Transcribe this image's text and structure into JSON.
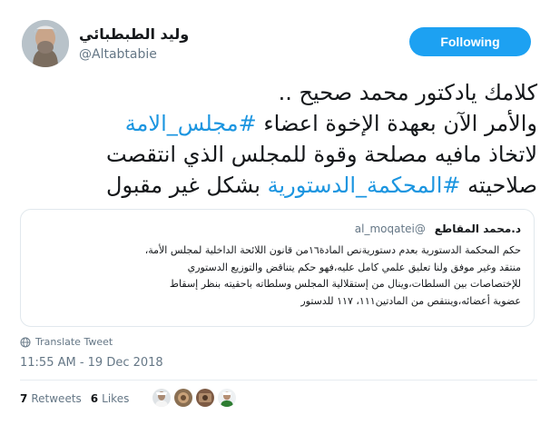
{
  "author": {
    "display_name": "وليد الطبطبائي",
    "handle": "@Altabtabie"
  },
  "follow_button": {
    "label": "Following"
  },
  "tweet": {
    "lines": [
      [
        {
          "text": "كلامك يادكتور محمد صحيح ..",
          "hashtag": false
        }
      ],
      [
        {
          "text": "والأمر الآن بعهدة الإخوة اعضاء ",
          "hashtag": false
        },
        {
          "text": "#مجلس_الامة",
          "hashtag": true
        }
      ],
      [
        {
          "text": "لاتخاذ مافيه مصلحة وقوة للمجلس الذي انتقصت",
          "hashtag": false
        }
      ],
      [
        {
          "text": "صلاحيته ",
          "hashtag": false
        },
        {
          "text": "#المحكمة_الدستورية",
          "hashtag": true
        },
        {
          "text": " بشكل غير مقبول",
          "hashtag": false
        }
      ]
    ]
  },
  "quoted_tweet": {
    "name": "د.محمد المقاطع",
    "handle": "@al_moqatei",
    "lines": [
      "حكم المحكمة الدستورية بعدم دستوريةنص المادة١٦من قانون اللائحة الداخلية لمجلس الأمة،",
      "منتقد وغير موفق ولنا تعليق علمي كامل عليه،فهو حكم يتناقض والتوزيع الدستوري",
      "للإختصاصات بين السلطات،وينال من إستقلالية المجلس وسلطاته باحقيته بنظر إسقاط",
      "عضوية أعضائه،وينتقص من المادتين١١١، ١١٧ للدستور"
    ]
  },
  "translate_link": "Translate Tweet",
  "timestamp": "11:55 AM - 19 Dec 2018",
  "stats": {
    "retweets_count": "7",
    "retweets_label": "Retweets",
    "likes_count": "6",
    "likes_label": "Likes"
  },
  "icons": {
    "translate": "globe-icon"
  },
  "colors": {
    "accent": "#1da1f2",
    "hashtag": "#1b95e0",
    "muted": "#657786"
  }
}
